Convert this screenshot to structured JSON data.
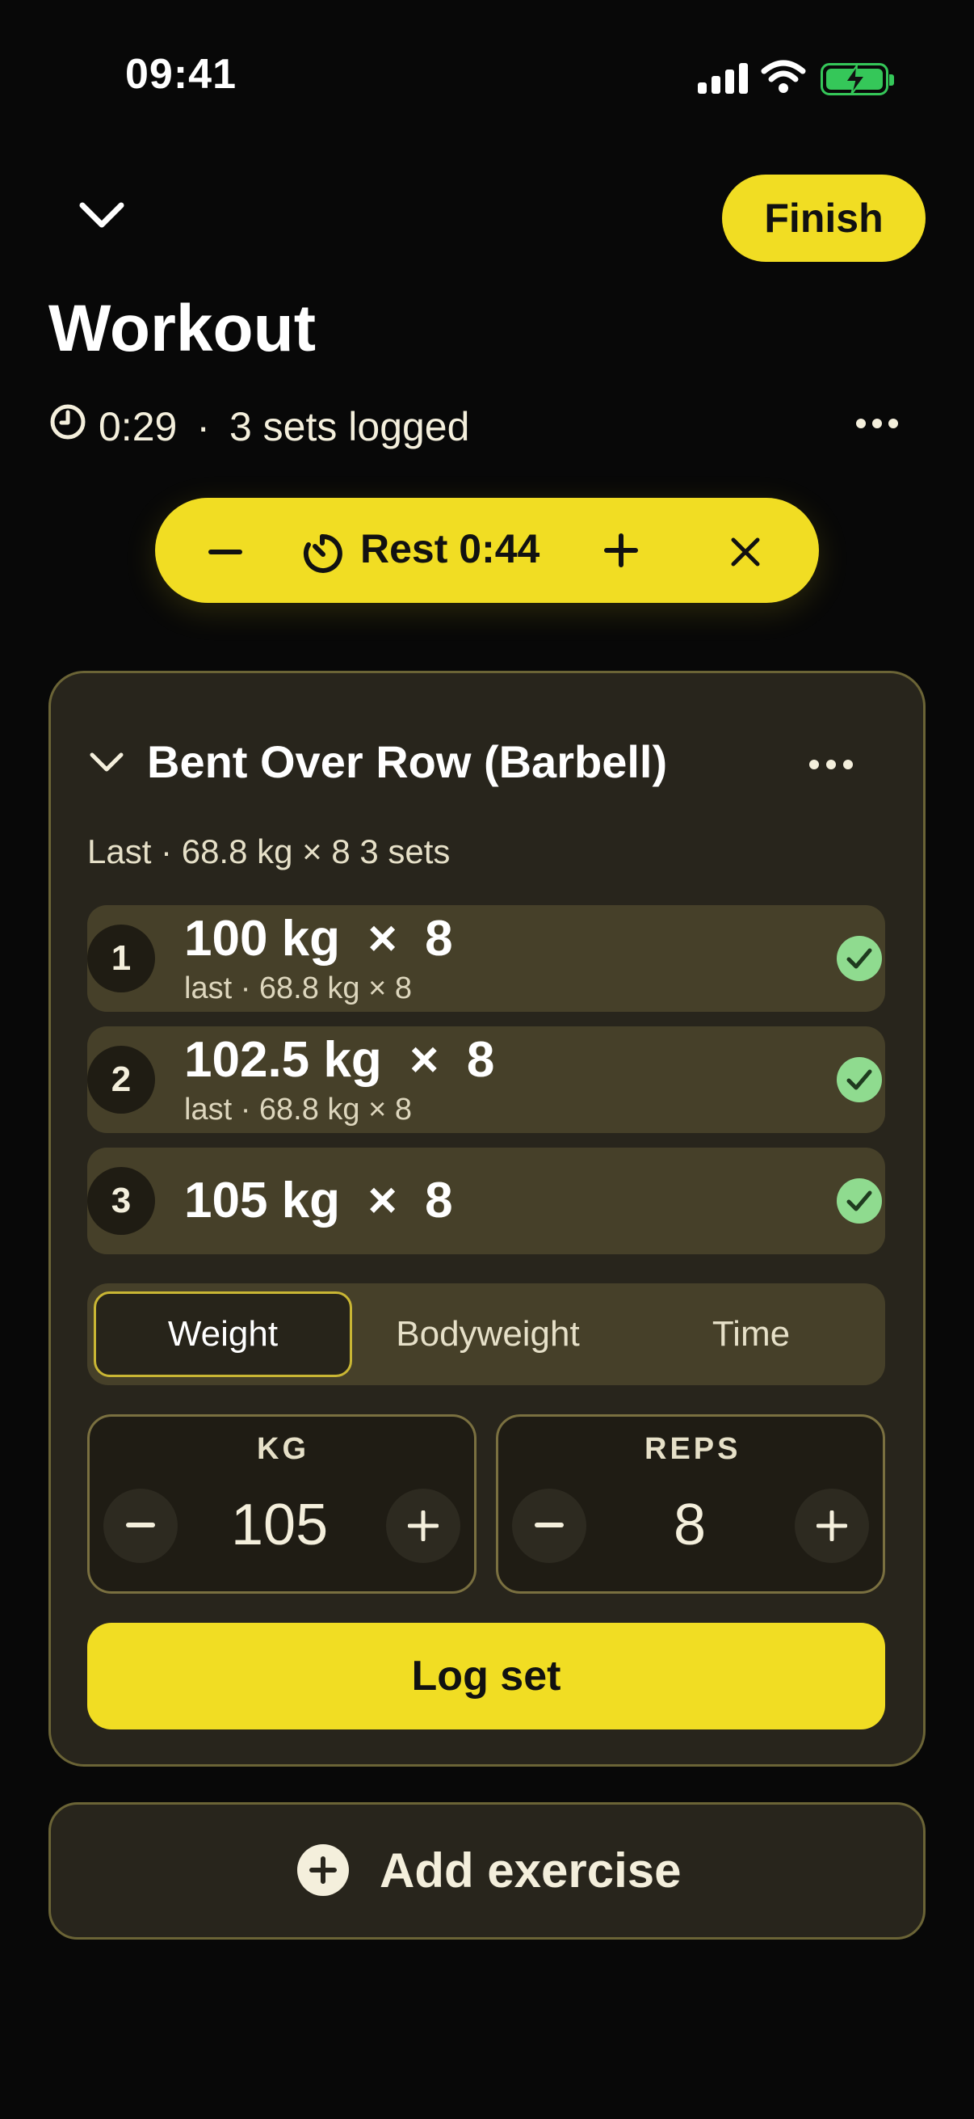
{
  "status_bar": {
    "time": "09:41"
  },
  "header": {
    "finish_label": "Finish",
    "title": "Workout",
    "elapsed": "0:29",
    "separator": "·",
    "sets_logged": "3 sets logged"
  },
  "rest_timer": {
    "label": "Rest 0:44"
  },
  "exercise": {
    "name": "Bent Over Row (Barbell)",
    "last_info": "Last · 68.8 kg × 8  3 sets",
    "sets": [
      {
        "number": "1",
        "main": "100 kg  ×  8",
        "sub": "last · 68.8 kg × 8",
        "completed": true
      },
      {
        "number": "2",
        "main": "102.5 kg  ×  8",
        "sub": "last · 68.8 kg × 8",
        "completed": true
      },
      {
        "number": "3",
        "main": "105 kg  ×  8",
        "sub": "",
        "completed": true
      }
    ],
    "modes": [
      "Weight",
      "Bodyweight",
      "Time"
    ],
    "selected_mode": "Weight",
    "weight": {
      "label": "KG",
      "value": "105"
    },
    "reps": {
      "label": "REPS",
      "value": "8"
    },
    "log_label": "Log set"
  },
  "add_exercise_label": "Add exercise",
  "colors": {
    "accent": "#f1dd23",
    "check": "#8fdb8f",
    "card": "#28251c",
    "background": "#080808"
  }
}
